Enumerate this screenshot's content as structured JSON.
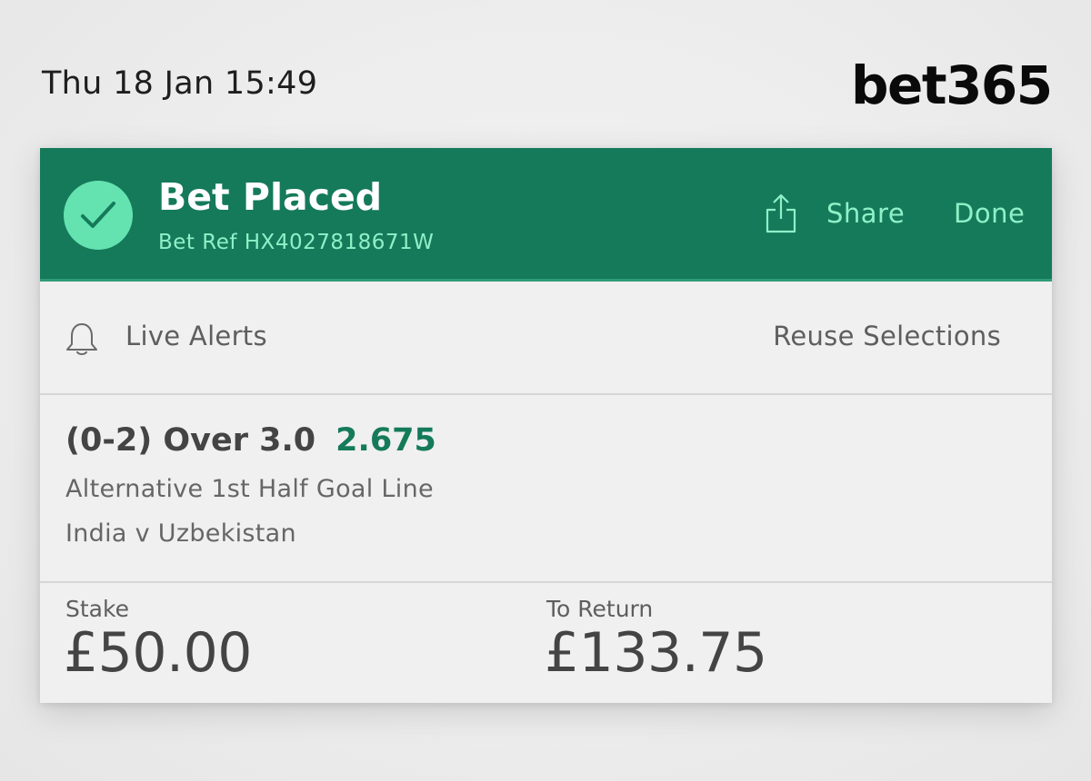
{
  "status_bar": {
    "datetime": "Thu 18 Jan 15:49"
  },
  "brand": {
    "logo": "bet365"
  },
  "header": {
    "icon": "checkmark-circle-icon",
    "title": "Bet Placed",
    "bet_ref": "Bet Ref HX4027818671W",
    "share_icon": "share-icon",
    "share_label": "Share",
    "done_label": "Done"
  },
  "alerts_row": {
    "icon": "bell-icon",
    "live_alerts_label": "Live Alerts",
    "reuse_label": "Reuse Selections"
  },
  "selection": {
    "title": "(0-2) Over 3.0",
    "odds": "2.675",
    "market": "Alternative 1st Half Goal Line",
    "event": "India v Uzbekistan"
  },
  "amounts": {
    "stake_label": "Stake",
    "stake_value": "£50.00",
    "return_label": "To Return",
    "return_value": "£133.75"
  },
  "colors": {
    "header_green": "#157a5a",
    "accent_mint": "#64e3b1",
    "odds_green": "#157a5a"
  }
}
